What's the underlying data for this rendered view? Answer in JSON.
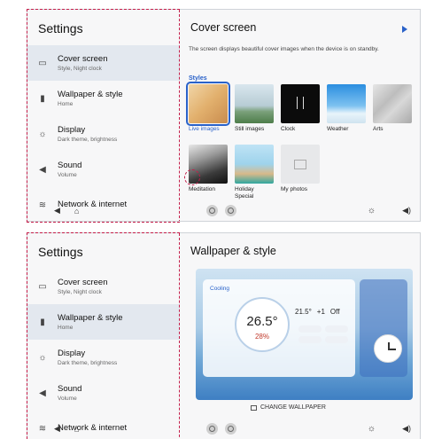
{
  "screen1": {
    "settings_title": "Settings",
    "menu": [
      {
        "label": "Cover screen",
        "sub": "Style, Night clock",
        "icon": "cover-screen-icon",
        "active": true
      },
      {
        "label": "Wallpaper & style",
        "sub": "Home",
        "icon": "wallpaper-icon",
        "active": false
      },
      {
        "label": "Display",
        "sub": "Dark theme, brightness",
        "icon": "display-brightness-icon",
        "active": false
      },
      {
        "label": "Sound",
        "sub": "Volume",
        "icon": "sound-icon",
        "active": false
      },
      {
        "label": "Network & internet",
        "sub": "",
        "icon": "wifi-icon",
        "active": false
      }
    ],
    "right_title": "Cover screen",
    "description": "The screen displays beautiful cover images when the device is on standby.",
    "styles_label": "Styles",
    "styles": [
      {
        "label": "Live images",
        "selected": true
      },
      {
        "label": "Still images",
        "selected": false
      },
      {
        "label": "Clock",
        "selected": false
      },
      {
        "label": "Weather",
        "selected": false
      },
      {
        "label": "Arts",
        "selected": false
      },
      {
        "label": "Meditation",
        "selected": false
      },
      {
        "label": "Holiday Special",
        "selected": false
      },
      {
        "label": "My photos",
        "selected": false
      }
    ]
  },
  "screen2": {
    "settings_title": "Settings",
    "menu": [
      {
        "label": "Cover screen",
        "sub": "Style, Night clock",
        "icon": "cover-screen-icon",
        "active": false
      },
      {
        "label": "Wallpaper & style",
        "sub": "Home",
        "icon": "wallpaper-icon",
        "active": true
      },
      {
        "label": "Display",
        "sub": "Dark theme, brightness",
        "icon": "display-brightness-icon",
        "active": false
      },
      {
        "label": "Sound",
        "sub": "Volume",
        "icon": "sound-icon",
        "active": false
      },
      {
        "label": "Network & internet",
        "sub": "",
        "icon": "wifi-icon",
        "active": false
      }
    ],
    "right_title": "Wallpaper & style",
    "preview": {
      "mode": "Cooling",
      "target_temp": "26.5°",
      "humidity": "28%",
      "stat1": "21.5°",
      "stat2": "+1",
      "stat3": "Off"
    },
    "change_wallpaper": "CHANGE WALLPAPER"
  },
  "colors": {
    "accent": "#2a62c9",
    "highlight_dash": "#c41e4a",
    "active_menu_bg": "#e3e8ef"
  }
}
